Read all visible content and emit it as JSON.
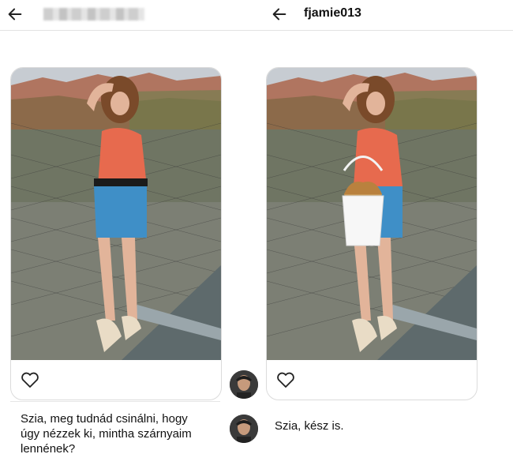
{
  "header": {
    "back_icon": "arrow-left-icon",
    "left_username_blurred": true,
    "right_username": "fjamie013"
  },
  "posts": [
    {
      "id": "original",
      "heart_icon": "heart-outline-icon"
    },
    {
      "id": "edited",
      "heart_icon": "heart-outline-icon"
    }
  ],
  "messages": {
    "left": "Szia, meg tudnád csinálni, hogy úgy nézzek ki, mintha szárnyaim lennének?",
    "right": "Szia, kész is."
  },
  "colors": {
    "background": "#ffffff",
    "divider": "#e3e3e3",
    "card_border": "#dbdbdb",
    "text": "#111111"
  }
}
